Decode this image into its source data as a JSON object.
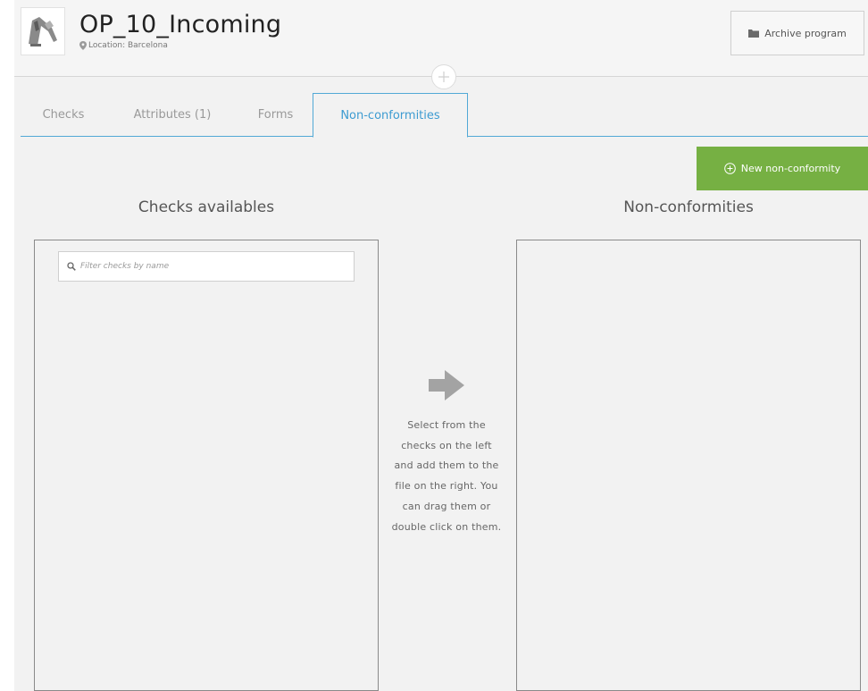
{
  "header": {
    "title": "OP_10_Incoming",
    "location": "Location: Barcelona",
    "archive_label": "Archive program"
  },
  "tabs": [
    {
      "label": "Checks",
      "active": false
    },
    {
      "label": "Attributes (1)",
      "active": false
    },
    {
      "label": "Forms",
      "active": false
    },
    {
      "label": "Non-conformities",
      "active": true
    }
  ],
  "actions": {
    "new_nc_label": "New non-conformity"
  },
  "left_column": {
    "heading": "Checks availables",
    "filter_placeholder": "Filter checks by name"
  },
  "right_column": {
    "heading": "Non-conformities"
  },
  "help": {
    "text": "Select from the checks on the left and add them to the file on the right. You can drag them or double click on them."
  },
  "icons": {
    "location": "map-marker-icon",
    "archive": "folder-icon",
    "add": "plus-icon",
    "new_nc": "plus-circle-icon",
    "search": "search-icon",
    "arrow": "arrow-right-icon"
  },
  "colors": {
    "accent_blue": "#3d9bd1",
    "green_button": "#76b043",
    "background": "#f2f2f2"
  }
}
